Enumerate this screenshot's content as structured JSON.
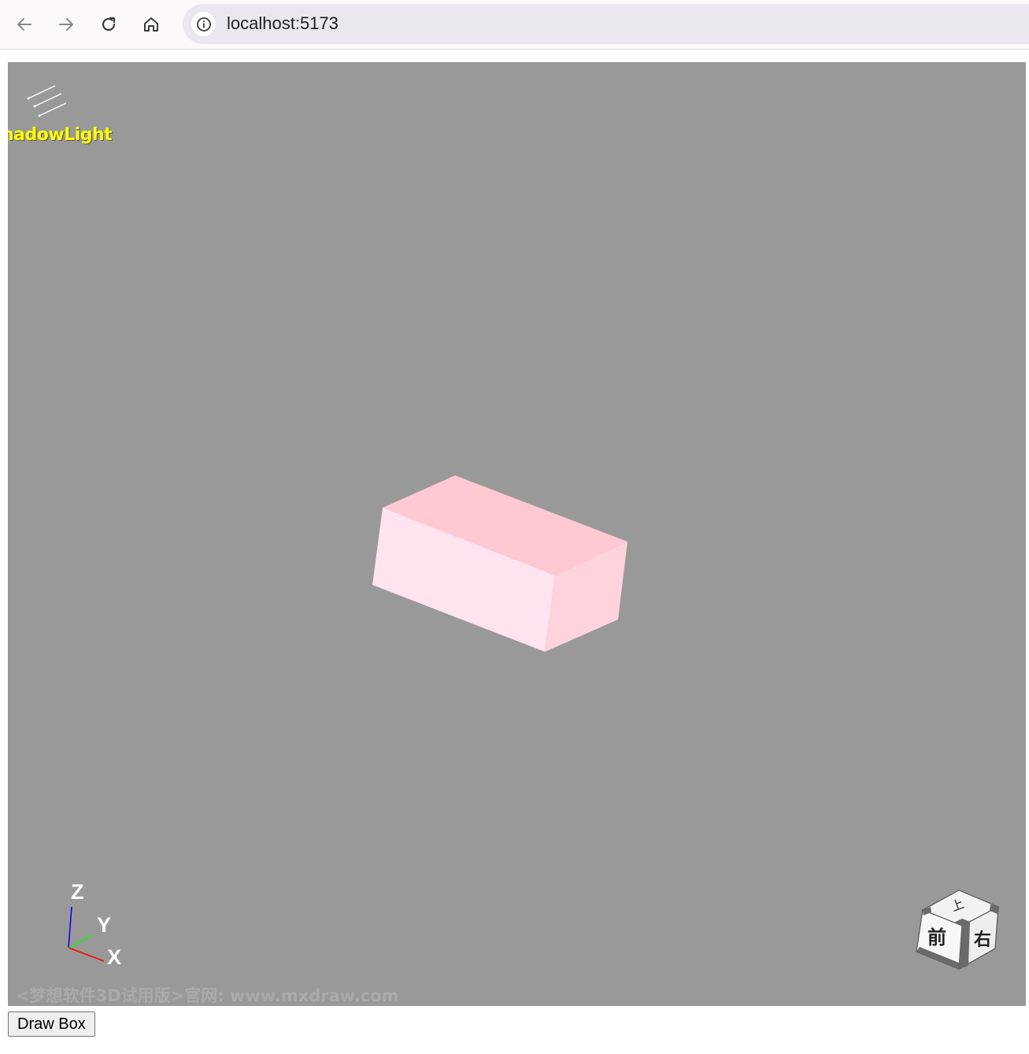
{
  "browser": {
    "url": "localhost:5173",
    "back_icon": "arrow-left-icon",
    "forward_icon": "arrow-right-icon",
    "reload_icon": "reload-icon",
    "home_icon": "home-icon",
    "info_icon": "info-icon"
  },
  "viewer": {
    "background_color": "#999999",
    "light_label": "hadowLight",
    "box_colors": {
      "top": "#ffc9d4",
      "front": "#ffe3ef",
      "right": "#ffd3dc"
    },
    "axes": {
      "z_label": "Z",
      "y_label": "Y",
      "x_label": "X",
      "x_color": "#ff0000",
      "y_color": "#00ff00",
      "z_color": "#0000ff"
    },
    "view_cube": {
      "top_label": "上",
      "front_label": "前",
      "right_label": "右"
    },
    "watermark": "<梦想软件3D试用版>官网: www.mxdraw.com"
  },
  "actions": {
    "draw_box_label": "Draw Box"
  }
}
